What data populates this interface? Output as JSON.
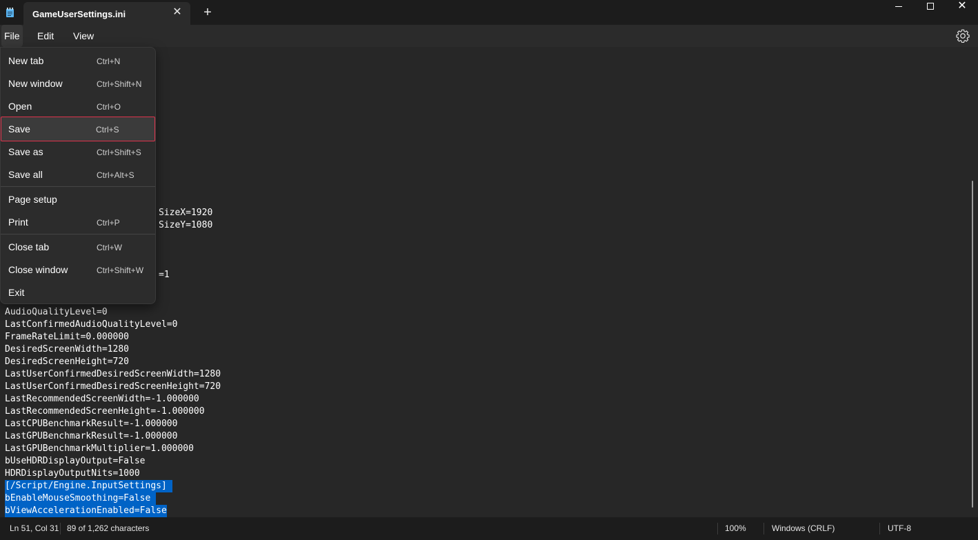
{
  "window": {
    "tab_title": "GameUserSettings.ini",
    "tab_close_glyph": "✕",
    "new_tab_glyph": "+",
    "close_glyph": "✕"
  },
  "menubar": {
    "items": [
      "File",
      "Edit",
      "View"
    ]
  },
  "file_menu": {
    "items": [
      {
        "label": "New tab",
        "shortcut": "Ctrl+N"
      },
      {
        "label": "New window",
        "shortcut": "Ctrl+Shift+N"
      },
      {
        "label": "Open",
        "shortcut": "Ctrl+O"
      },
      {
        "label": "Save",
        "shortcut": "Ctrl+S"
      },
      {
        "label": "Save as",
        "shortcut": "Ctrl+Shift+S"
      },
      {
        "label": "Save all",
        "shortcut": "Ctrl+Alt+S"
      },
      {
        "label": "Page setup",
        "shortcut": ""
      },
      {
        "label": "Print",
        "shortcut": "Ctrl+P"
      },
      {
        "label": "Close tab",
        "shortcut": "Ctrl+W"
      },
      {
        "label": "Close window",
        "shortcut": "Ctrl+Shift+W"
      },
      {
        "label": "Exit",
        "shortcut": ""
      }
    ],
    "highlighted_item": "Save",
    "highlight_color": "#e0334c"
  },
  "editor": {
    "visible_line_fragments": [
      "SizeX=1920",
      "SizeY=1080",
      "=1"
    ],
    "lines": [
      "AudioQualityLevel=0",
      "LastConfirmedAudioQualityLevel=0",
      "FrameRateLimit=0.000000",
      "DesiredScreenWidth=1280",
      "DesiredScreenHeight=720",
      "LastUserConfirmedDesiredScreenWidth=1280",
      "LastUserConfirmedDesiredScreenHeight=720",
      "LastRecommendedScreenWidth=-1.000000",
      "LastRecommendedScreenHeight=-1.000000",
      "LastCPUBenchmarkResult=-1.000000",
      "LastGPUBenchmarkResult=-1.000000",
      "LastGPUBenchmarkMultiplier=1.000000",
      "bUseHDRDisplayOutput=False",
      "HDRDisplayOutputNits=1000",
      "[/Script/Engine.InputSettings]",
      "bEnableMouseSmoothing=False",
      "bViewAccelerationEnabled=False"
    ],
    "selection_color": "#0063c6"
  },
  "statusbar": {
    "position": "Ln 51, Col 31",
    "selection_info": "89 of 1,262 characters",
    "zoom": "100%",
    "line_ending": "Windows (CRLF)",
    "encoding": "UTF-8"
  },
  "icons": [
    "notepad-icon",
    "gear-icon",
    "minimize-icon",
    "maximize-icon",
    "close-icon"
  ]
}
